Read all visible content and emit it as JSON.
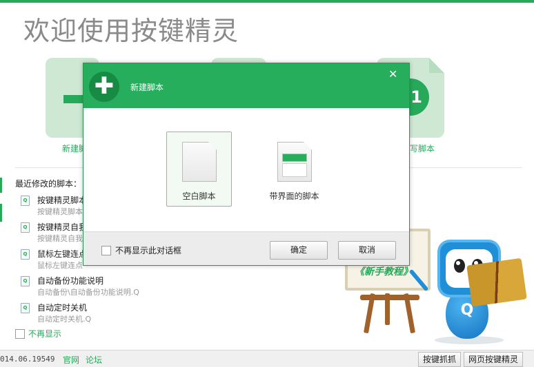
{
  "welcome": {
    "title": "欢迎使用按键精灵"
  },
  "cards": {
    "new_script_label": "新建脚",
    "write_script_label": "写脚本"
  },
  "recent": {
    "title": "最近修改的脚本：",
    "items": [
      {
        "name": "按键精灵脚本",
        "desc": "按键精灵脚本"
      },
      {
        "name": "按键精灵自我",
        "desc": "按键精灵自我"
      },
      {
        "name": "鼠标左键连点",
        "desc": "鼠标左键连点"
      },
      {
        "name": "自动备份功能说明",
        "desc": "自动备份\\自动备份功能说明.Q"
      },
      {
        "name": "自动定时关机",
        "desc": "自动定时关机.Q"
      }
    ],
    "file_icon_letter": "Q",
    "no_show_label": "不再显示"
  },
  "easel": {
    "text": "《新手教程》"
  },
  "mascot": {
    "letter": "Q"
  },
  "status": {
    "version": "014.06.19549",
    "links": [
      "官网",
      "论坛"
    ],
    "buttons": [
      "按键抓抓",
      "网页按键精灵"
    ]
  },
  "dialog": {
    "title": "新建脚本",
    "close": "✕",
    "header_icon": "✚",
    "options": [
      {
        "label": "空白脚本",
        "selected": true
      },
      {
        "label": "带界面的脚本",
        "selected": false
      }
    ],
    "dont_show_label": "不再显示此对话框",
    "ok_label": "确定",
    "cancel_label": "取消"
  },
  "colors": {
    "accent": "#27ae5c",
    "accent_dark": "#178a43"
  }
}
